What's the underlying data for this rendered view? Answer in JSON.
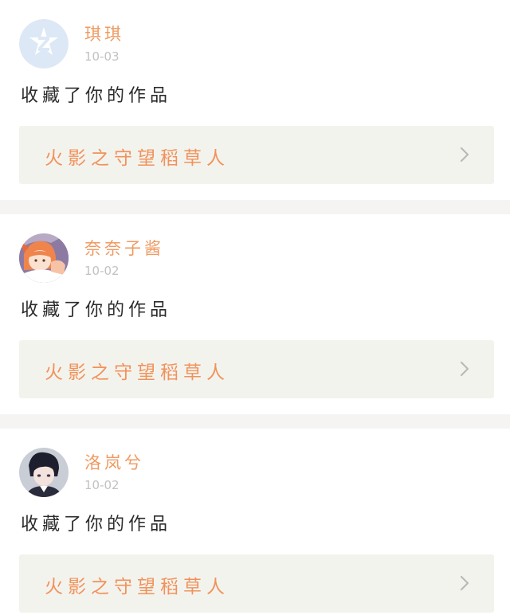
{
  "notifications": [
    {
      "username": "琪琪",
      "date": "10-03",
      "action": "收藏了你的作品",
      "work_title": "火影之守望稻草人",
      "avatar_icon": "default-qq-avatar-icon"
    },
    {
      "username": "奈奈子酱",
      "date": "10-02",
      "action": "收藏了你的作品",
      "work_title": "火影之守望稻草人",
      "avatar_icon": "anime-girl-avatar"
    },
    {
      "username": "洛岚兮",
      "date": "10-02",
      "action": "收藏了你的作品",
      "work_title": "火影之守望稻草人",
      "avatar_icon": "anime-boy-avatar"
    }
  ],
  "colors": {
    "username": "#ef9a62",
    "work_title": "#f1925a",
    "date": "#c2c2c2",
    "card_link_bg": "#f3f3ee",
    "separator": "#f6f3f3"
  }
}
